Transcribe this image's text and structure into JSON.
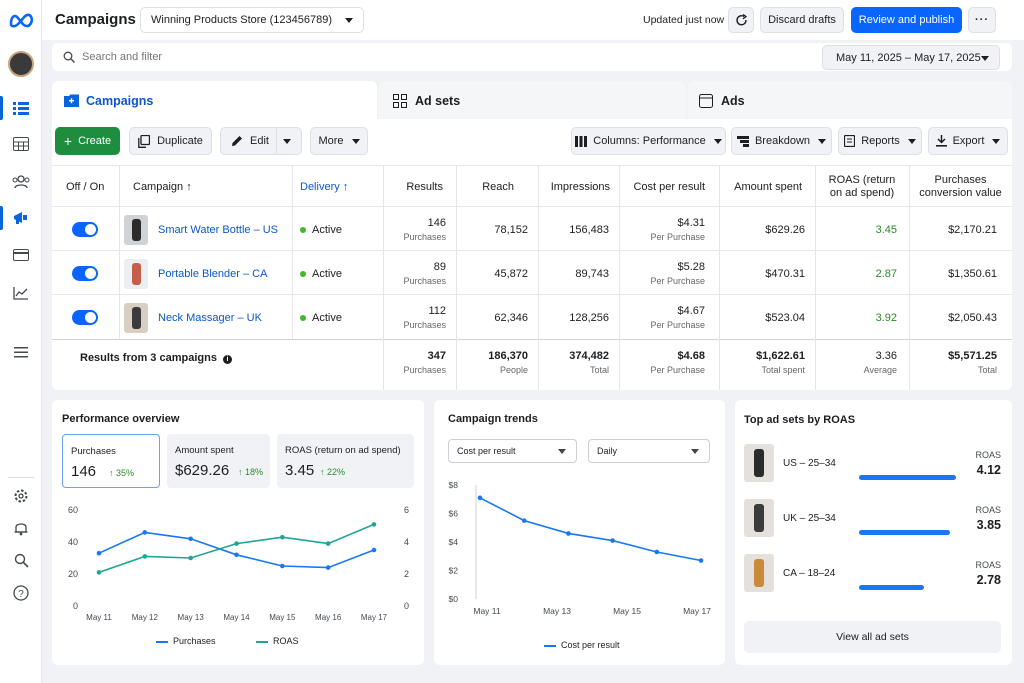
{
  "header": {
    "title": "Campaigns",
    "account": "Winning Products Store (123456789)",
    "status": "Updated just now",
    "discard_label": "Discard drafts",
    "publish_label": "Review and publish",
    "more_icon": "ellipsis-icon"
  },
  "search": {
    "placeholder": "Search and filter",
    "date_range": "May 11, 2025 – May 17, 2025"
  },
  "tabs": [
    {
      "label": "Campaigns",
      "active": true
    },
    {
      "label": "Ad sets",
      "active": false
    },
    {
      "label": "Ads",
      "active": false
    }
  ],
  "toolbar": {
    "create": "Create",
    "duplicate": "Duplicate",
    "edit": "Edit",
    "more": "More",
    "columns": "Columns: Performance",
    "breakdown": "Breakdown",
    "reports": "Reports",
    "export": "Export"
  },
  "table": {
    "headers": {
      "onoff": "Off / On",
      "campaign": "Campaign",
      "delivery": "Delivery",
      "results": "Results",
      "reach": "Reach",
      "impressions": "Impressions",
      "cpr": "Cost per result",
      "spent": "Amount spent",
      "roas_1": "ROAS (return",
      "roas_2": "on ad spend)",
      "pcv_1": "Purchases",
      "pcv_2": "conversion value"
    },
    "rows": [
      {
        "name": "Smart Water Bottle – US",
        "delivery": "Active",
        "results": "146",
        "results_sub": "Purchases",
        "reach": "78,152",
        "impressions": "156,483",
        "cpr": "$4.31",
        "cpr_sub": "Per Purchase",
        "spent": "$629.26",
        "roas": "3.45",
        "pcv": "$2,170.21"
      },
      {
        "name": "Portable Blender – CA",
        "delivery": "Active",
        "results": "89",
        "results_sub": "Purchases",
        "reach": "45,872",
        "impressions": "89,743",
        "cpr": "$5.28",
        "cpr_sub": "Per Purchase",
        "spent": "$470.31",
        "roas": "2.87",
        "pcv": "$1,350.61"
      },
      {
        "name": "Neck Massager – UK",
        "delivery": "Active",
        "results": "112",
        "results_sub": "Purchases",
        "reach": "62,346",
        "impressions": "128,256",
        "cpr": "$4.67",
        "cpr_sub": "Per Purchase",
        "spent": "$523.04",
        "roas": "3.92",
        "pcv": "$2,050.43"
      }
    ],
    "totals": {
      "label": "Results from 3 campaigns",
      "results": "347",
      "results_sub": "Purchases",
      "reach": "186,370",
      "reach_sub": "People",
      "impressions": "374,482",
      "impressions_sub": "Total",
      "cpr": "$4.68",
      "cpr_sub": "Per Purchase",
      "spent": "$1,622.61",
      "spent_sub": "Total spent",
      "roas": "3.36",
      "roas_sub": "Average",
      "pcv": "$5,571.25",
      "pcv_sub": "Total"
    }
  },
  "performance": {
    "title": "Performance overview",
    "metrics": [
      {
        "label": "Purchases",
        "value": "146",
        "delta": "35%"
      },
      {
        "label": "Amount spent",
        "value": "$629.26",
        "delta": "18%"
      },
      {
        "label": "ROAS (return on ad spend)",
        "value": "3.45",
        "delta": "22%"
      }
    ],
    "legend": [
      "Purchases",
      "ROAS"
    ]
  },
  "trends": {
    "title": "Campaign trends",
    "metric_select": "Cost per result",
    "period_select": "Daily",
    "legend": "Cost per result"
  },
  "top_adsets": {
    "title": "Top ad sets by ROAS",
    "items": [
      {
        "name": "US – 25–34",
        "label": "ROAS",
        "value": "4.12",
        "share": 0.81
      },
      {
        "name": "UK – 25–34",
        "label": "ROAS",
        "value": "3.85",
        "share": 0.76
      },
      {
        "name": "CA – 18–24",
        "label": "ROAS",
        "value": "2.78",
        "share": 0.54
      }
    ],
    "view_all": "View all ad sets"
  },
  "chart_data": [
    {
      "type": "line",
      "x": [
        "May 11",
        "May 12",
        "May 13",
        "May 14",
        "May 15",
        "May 16",
        "May 17"
      ],
      "series": [
        {
          "name": "Purchases",
          "axis": "left",
          "color": "#1877f2",
          "values": [
            33,
            46,
            42,
            32,
            25,
            24,
            35
          ]
        },
        {
          "name": "ROAS",
          "axis": "right",
          "color": "#1ea595",
          "values": [
            2.1,
            3.1,
            3.0,
            3.9,
            4.3,
            3.9,
            5.1
          ]
        }
      ],
      "ylim": [
        0,
        60
      ],
      "y2lim": [
        0,
        6
      ],
      "yticks": [
        "0",
        "20",
        "40",
        "60"
      ],
      "y2ticks": [
        "0",
        "2",
        "4",
        "6"
      ]
    },
    {
      "type": "line",
      "x": [
        "May 11",
        "May 13",
        "May 15",
        "May 17"
      ],
      "series": [
        {
          "name": "Cost per result",
          "color": "#1877f2",
          "values": [
            7.1,
            5.5,
            4.6,
            4.1,
            3.3,
            2.7
          ]
        }
      ],
      "ylim": [
        0,
        8
      ],
      "yticks": [
        "$0",
        "$2",
        "$4",
        "$6",
        "$8"
      ]
    }
  ]
}
